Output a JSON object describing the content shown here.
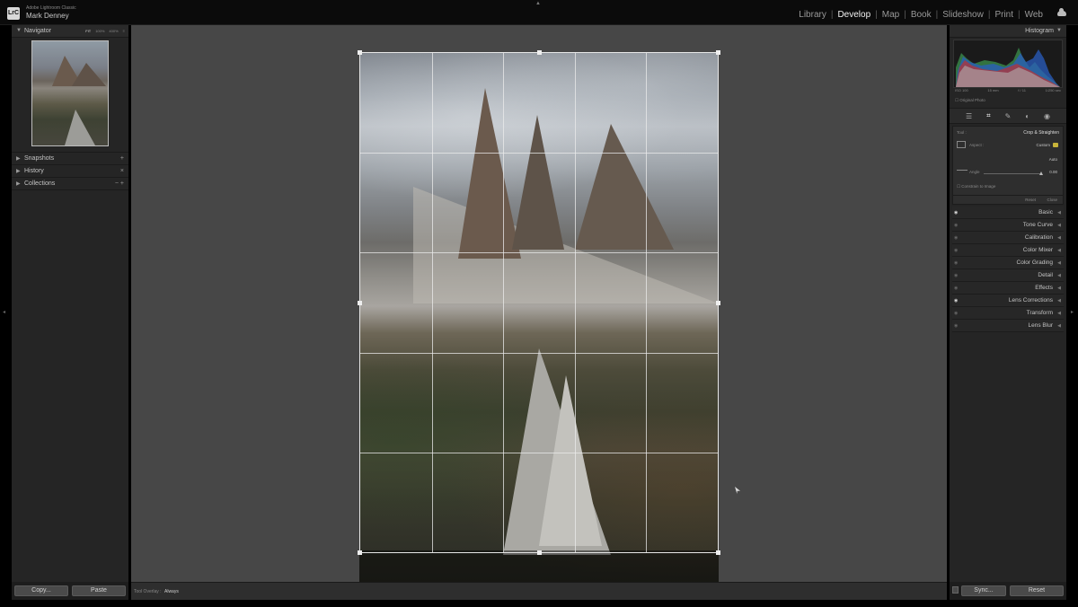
{
  "app": {
    "name": "Adobe Lightroom Classic",
    "logo": "LrC",
    "user": "Mark Denney"
  },
  "modules": [
    "Library",
    "Develop",
    "Map",
    "Book",
    "Slideshow",
    "Print",
    "Web"
  ],
  "active_module": "Develop",
  "left_panel": {
    "navigator": {
      "title": "Navigator",
      "zoom_options": [
        "FIT",
        "100%",
        "400%",
        "≡"
      ]
    },
    "sections": [
      {
        "title": "Snapshots",
        "action": "+"
      },
      {
        "title": "History",
        "action": "×"
      },
      {
        "title": "Collections",
        "action": "− +"
      }
    ],
    "footer": {
      "copy": "Copy...",
      "paste": "Paste"
    }
  },
  "toolbar": {
    "tool_overlay_label": "Tool Overlay :",
    "tool_overlay_value": "Always"
  },
  "right_panel": {
    "histogram_title": "Histogram",
    "histogram_readout": [
      "ISO 100",
      "15 mm",
      "f / 11",
      "1/250 sec"
    ],
    "original_photo": "Original Photo",
    "tools": [
      "sliders-icon",
      "crop-icon",
      "heal-icon",
      "masking-icon",
      "redeye-icon"
    ],
    "crop": {
      "tool_label": "Tool :",
      "tool_value": "Crop & Straighten",
      "aspect_label": "Aspect :",
      "aspect_value": "Custom",
      "auto": "Auto",
      "angle_label": "Angle",
      "angle_value": "0.00",
      "constrain": "Constrain to Image",
      "reset": "Reset",
      "close": "Close"
    },
    "panels": [
      {
        "label": "Basic",
        "eye": true
      },
      {
        "label": "Tone Curve",
        "eye": false
      },
      {
        "label": "Calibration",
        "eye": false
      },
      {
        "label": "Color Mixer",
        "eye": false
      },
      {
        "label": "Color Grading",
        "eye": false
      },
      {
        "label": "Detail",
        "eye": false
      },
      {
        "label": "Effects",
        "eye": false
      },
      {
        "label": "Lens Corrections",
        "eye": true
      },
      {
        "label": "Transform",
        "eye": false
      },
      {
        "label": "Lens Blur",
        "eye": false
      }
    ],
    "footer": {
      "sync": "Sync...",
      "reset": "Reset"
    }
  },
  "colors": {
    "accent_lock": "#c8b43a",
    "panel_bg": "#252525",
    "canvas_bg": "#474747"
  }
}
